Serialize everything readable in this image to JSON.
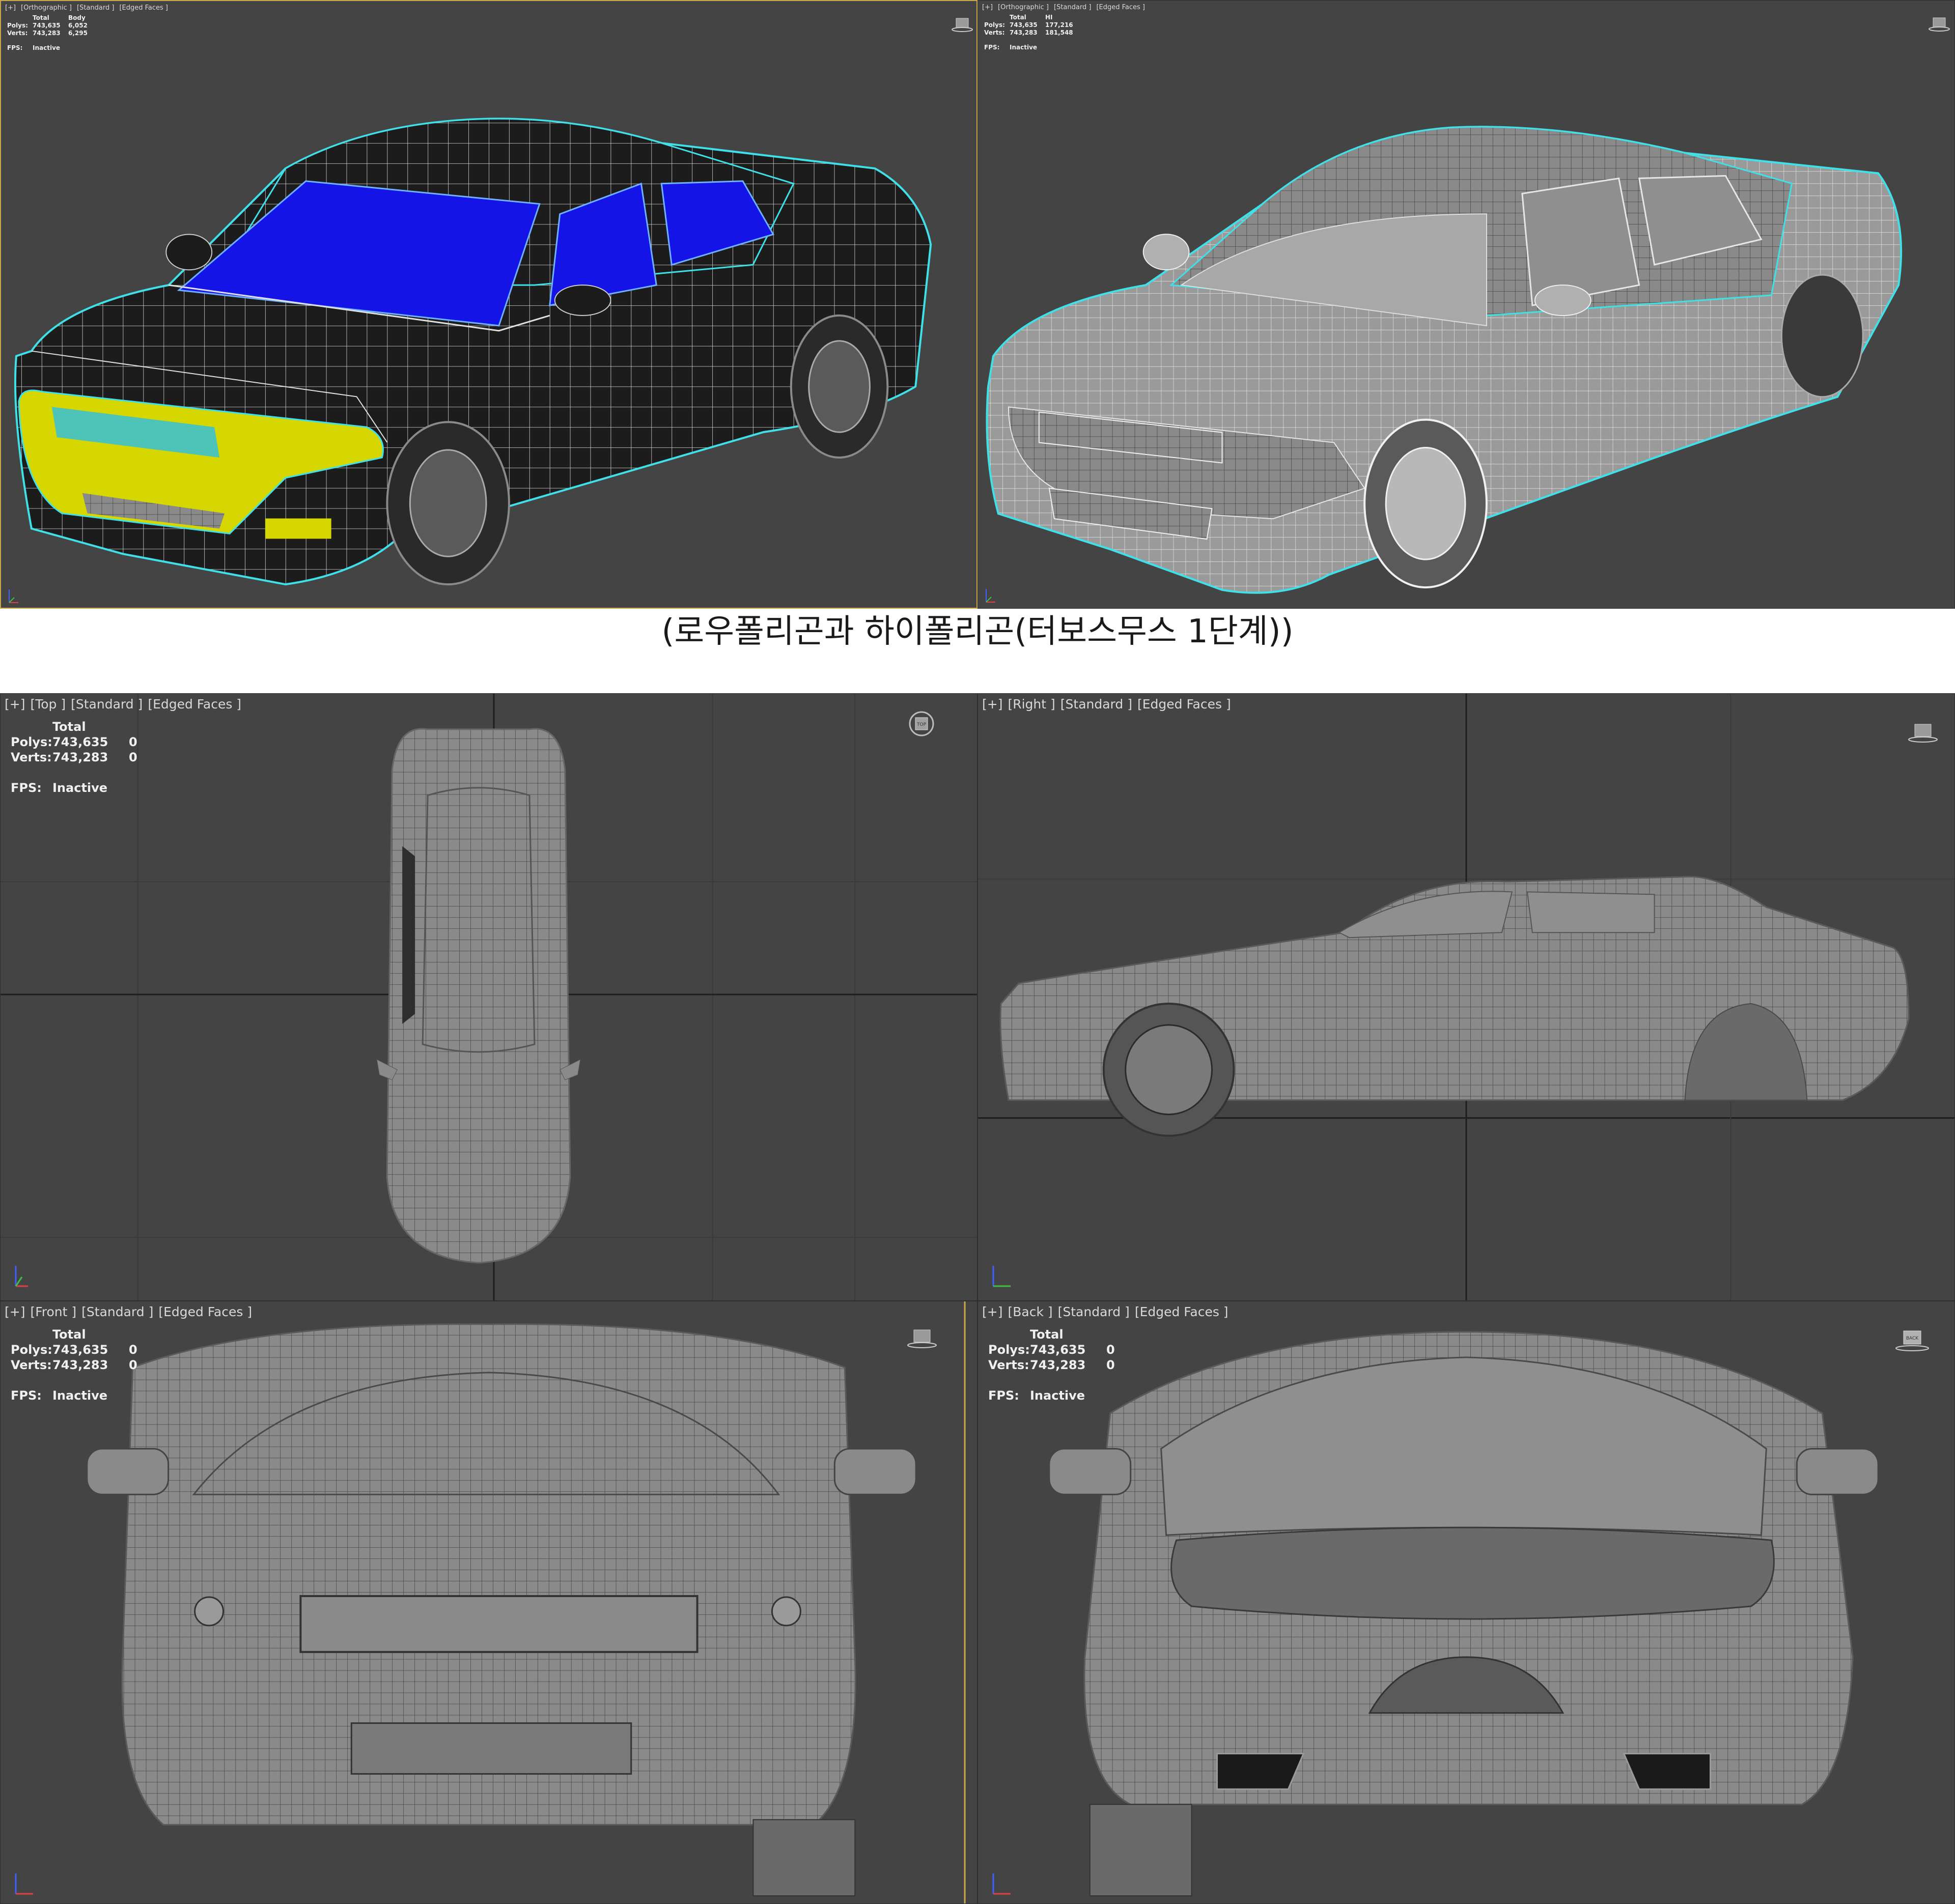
{
  "caption": "(로우폴리곤과 하이폴리곤(터보스무스 1단계))",
  "colors": {
    "viewport_bg": "#444444",
    "grid_line": "#2c2c2c",
    "selection_outline": "#40e0e8",
    "glass_blue": "#1414e6",
    "bumper_yellow": "#e0e000",
    "active_border": "#c9a94a"
  },
  "viewports": [
    {
      "id": "top-left",
      "label": {
        "plus": "[+]",
        "view": "[Orthographic ]",
        "shading": "[Standard ]",
        "edges": "[Edged Faces ]"
      },
      "stats": {
        "header_total": "Total",
        "header_col2": "Body",
        "polys_label": "Polys:",
        "polys_total": "743,635",
        "polys_sel": "6,052",
        "verts_label": "Verts:",
        "verts_total": "743,283",
        "verts_sel": "6,295",
        "fps_label": "FPS:",
        "fps_value": "Inactive"
      },
      "navcube_icon": "navcube-icon"
    },
    {
      "id": "top-right",
      "label": {
        "plus": "[+]",
        "view": "[Orthographic ]",
        "shading": "[Standard ]",
        "edges": "[Edged Faces ]"
      },
      "stats": {
        "header_total": "Total",
        "header_col2": "HI",
        "polys_label": "Polys:",
        "polys_total": "743,635",
        "polys_sel": "177,216",
        "verts_label": "Verts:",
        "verts_total": "743,283",
        "verts_sel": "181,548",
        "fps_label": "FPS:",
        "fps_value": "Inactive"
      },
      "navcube_icon": "navcube-icon"
    },
    {
      "id": "top-view",
      "label": {
        "plus": "[+]",
        "view": "[Top ]",
        "shading": "[Standard ]",
        "edges": "[Edged Faces ]"
      },
      "stats": {
        "header_total": "Total",
        "header_col2": "",
        "polys_label": "Polys:",
        "polys_total": "743,635",
        "polys_sel": "0",
        "verts_label": "Verts:",
        "verts_total": "743,283",
        "verts_sel": "0",
        "fps_label": "FPS:",
        "fps_value": "Inactive"
      },
      "navcube_icon": "compass-navcube-icon",
      "navcube_text": "TOP"
    },
    {
      "id": "right-view",
      "label": {
        "plus": "[+]",
        "view": "[Right ]",
        "shading": "[Standard ]",
        "edges": "[Edged Faces ]"
      },
      "stats": null,
      "navcube_icon": "navcube-icon"
    },
    {
      "id": "front-view",
      "label": {
        "plus": "[+]",
        "view": "[Front ]",
        "shading": "[Standard ]",
        "edges": "[Edged Faces ]"
      },
      "stats": {
        "header_total": "Total",
        "header_col2": "",
        "polys_label": "Polys:",
        "polys_total": "743,635",
        "polys_sel": "0",
        "verts_label": "Verts:",
        "verts_total": "743,283",
        "verts_sel": "0",
        "fps_label": "FPS:",
        "fps_value": "Inactive"
      },
      "navcube_icon": "navcube-icon"
    },
    {
      "id": "back-view",
      "label": {
        "plus": "[+]",
        "view": "[Back ]",
        "shading": "[Standard ]",
        "edges": "[Edged Faces ]"
      },
      "stats": {
        "header_total": "Total",
        "header_col2": "",
        "polys_label": "Polys:",
        "polys_total": "743,635",
        "polys_sel": "0",
        "verts_label": "Verts:",
        "verts_total": "743,283",
        "verts_sel": "0",
        "fps_label": "FPS:",
        "fps_value": "Inactive"
      },
      "navcube_icon": "navcube-icon",
      "navcube_text": "BACK"
    }
  ]
}
